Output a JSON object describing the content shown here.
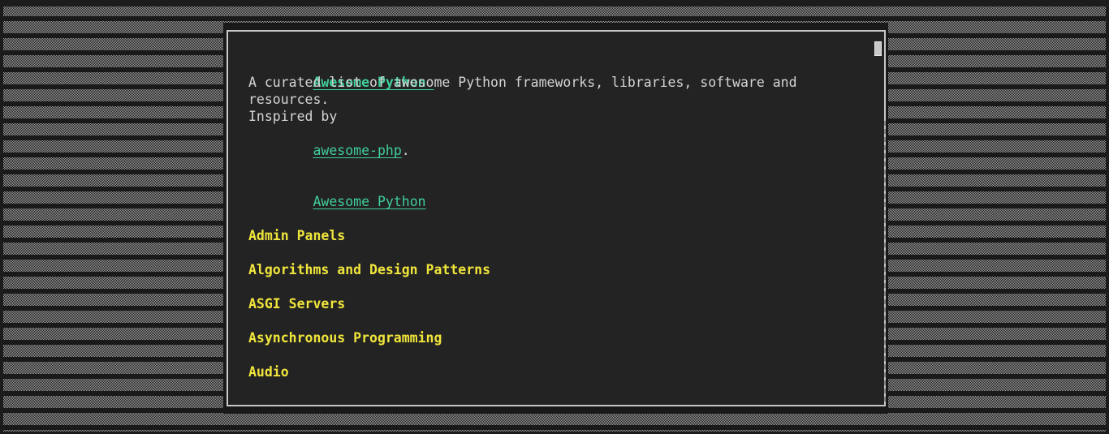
{
  "document": {
    "title": "Awesome Python ",
    "description_line1": "A curated list of awesome Python frameworks, libraries, software and",
    "description_line2": "resources.",
    "inspired_prefix": "Inspired by",
    "inspired_link": "awesome-php",
    "inspired_suffix": ".",
    "toc_link": "Awesome Python",
    "sections": [
      "Admin Panels",
      "Algorithms and Design Patterns",
      "ASGI Servers",
      "Asynchronous Programming",
      "Audio"
    ]
  },
  "colors": {
    "link": "#3fcf9a",
    "section_heading": "#f0e53c",
    "text": "#d4d4d4",
    "window_bg": "#232323"
  }
}
